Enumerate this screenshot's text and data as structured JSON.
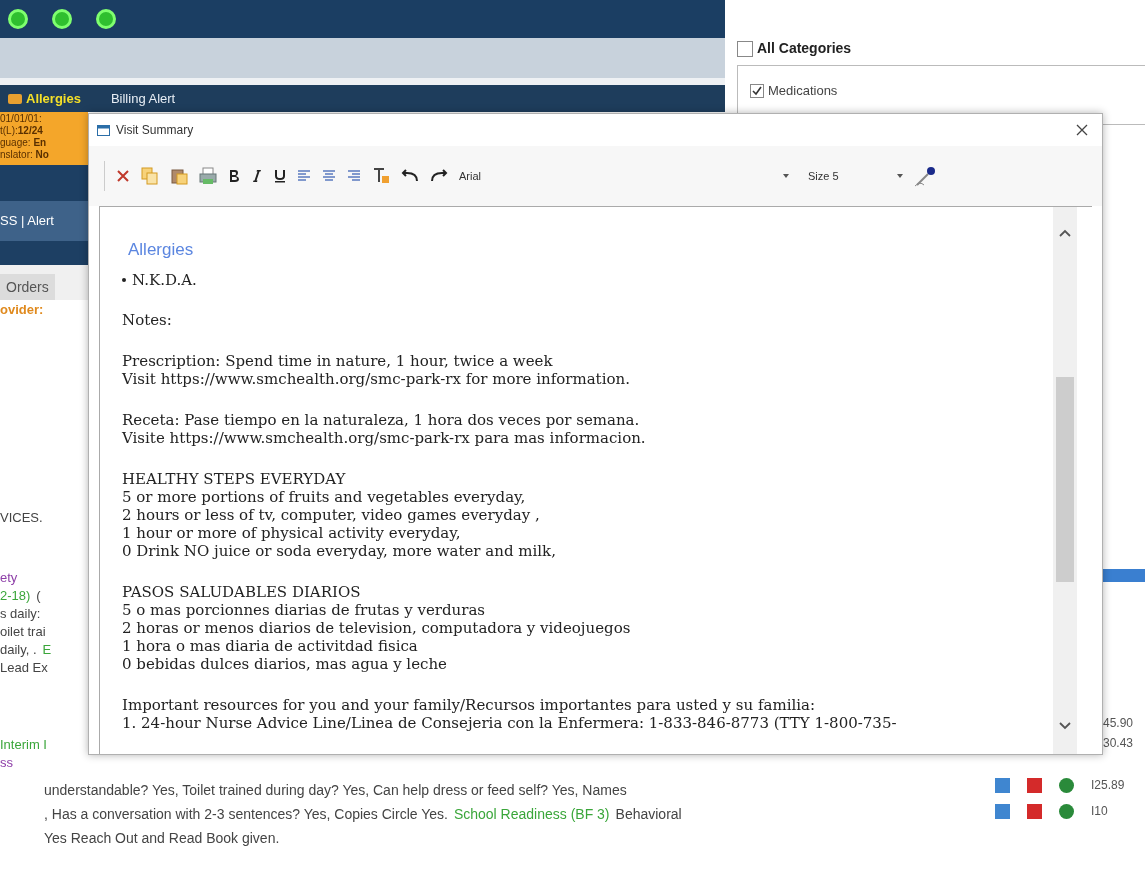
{
  "alert_bar": {
    "items": [
      {
        "label": "Allergies",
        "kind": "alert"
      },
      {
        "label": "Billing Alert",
        "kind": "plain"
      }
    ]
  },
  "patient_info": [
    "01/01/01:",
    "t(L):**12/24**",
    "guage: **En**",
    "nslator: **No**"
  ],
  "nav_links": "SS | Alert",
  "tabs": [
    {
      "label": "Orders",
      "selected": false
    }
  ],
  "background_lines": [
    {
      "segments": [
        {
          "text": "ovider:",
          "kind": "label"
        }
      ]
    },
    {
      "segments": [
        {
          "text": "VICES.",
          "kind": "text"
        }
      ]
    },
    {
      "segments": [
        {
          "text": "ety",
          "kind": "section"
        }
      ]
    },
    {
      "segments": [
        {
          "text": "2-18)",
          "kind": "link"
        },
        {
          "text": "(",
          "kind": "text"
        }
      ]
    },
    {
      "segments": [
        {
          "text": "s daily:",
          "kind": "text"
        }
      ]
    },
    {
      "segments": [
        {
          "text": "oilet trai",
          "kind": "text"
        }
      ]
    },
    {
      "segments": [
        {
          "text": "daily, .",
          "kind": "text"
        },
        {
          "text": "E",
          "kind": "link"
        }
      ]
    },
    {
      "segments": [
        {
          "text": "Lead Ex",
          "kind": "text"
        }
      ]
    },
    {
      "segments": [
        {
          "text": "Interim I",
          "kind": "link"
        }
      ]
    },
    {
      "segments": [
        {
          "text": "ss",
          "kind": "section"
        }
      ]
    },
    {
      "segments": [
        {
          "text": "understandable? Yes, Toilet trained during day? Yes, Can help dress or feed self? Yes, Names",
          "kind": "text"
        }
      ]
    },
    {
      "segments": [
        {
          "text": ", Has a conversation with 2-3 sentences? Yes, Copies Circle Yes.",
          "kind": "text"
        },
        {
          "text": "School Readiness (BF 3)",
          "kind": "link"
        },
        {
          "text": "Behavioral",
          "kind": "text"
        }
      ]
    },
    {
      "segments": [
        {
          "text": "Yes Reach Out and Read Book given.",
          "kind": "text"
        }
      ]
    }
  ],
  "filter": {
    "all_categories": {
      "label": "All Categories",
      "checked": false
    },
    "categories": [
      {
        "label": "Medications",
        "checked": true
      }
    ]
  },
  "partial_codes": [
    "45.90",
    "30.43"
  ],
  "codes": [
    "I25.89",
    "I10"
  ],
  "dialog": {
    "title": "Visit Summary",
    "font": "Arial",
    "size": "Size 5",
    "heading": "Allergies",
    "bullets": [
      "N.K.D.A."
    ],
    "paragraphs": [
      [
        "Notes:"
      ],
      [
        "Prescription: Spend time in nature, 1 hour, twice a week",
        "Visit https://www.smchealth.org/smc-park-rx for more information."
      ],
      [
        "Receta: Pase tiempo en la naturaleza, 1 hora dos veces por semana.",
        "Visite https://www.smchealth.org/smc-park-rx para mas informacion."
      ],
      [
        "HEALTHY STEPS EVERYDAY",
        "5 or more portions of fruits and vegetables everyday,",
        "2 hours or less of tv, computer, video games everyday ,",
        "1 hour or more of physical activity everyday,",
        "0 Drink NO juice or soda everyday, more water and milk,"
      ],
      [
        "PASOS SALUDABLES DIARIOS",
        "5 o mas porcionnes diarias de frutas y verduras",
        "2 horas or menos diarios de television, computadora y videojuegos",
        "1 hora o mas diaria de activitdad fisica",
        "0 bebidas dulces diarios, mas agua y leche"
      ],
      [
        "Important resources for you and your family/Recursos importantes para usted y su familia:",
        "1. 24-hour Nurse Advice Line/Linea de Consejeria con la Enfermera: 1-833-846-8773 (TTY 1-800-735-"
      ]
    ]
  }
}
